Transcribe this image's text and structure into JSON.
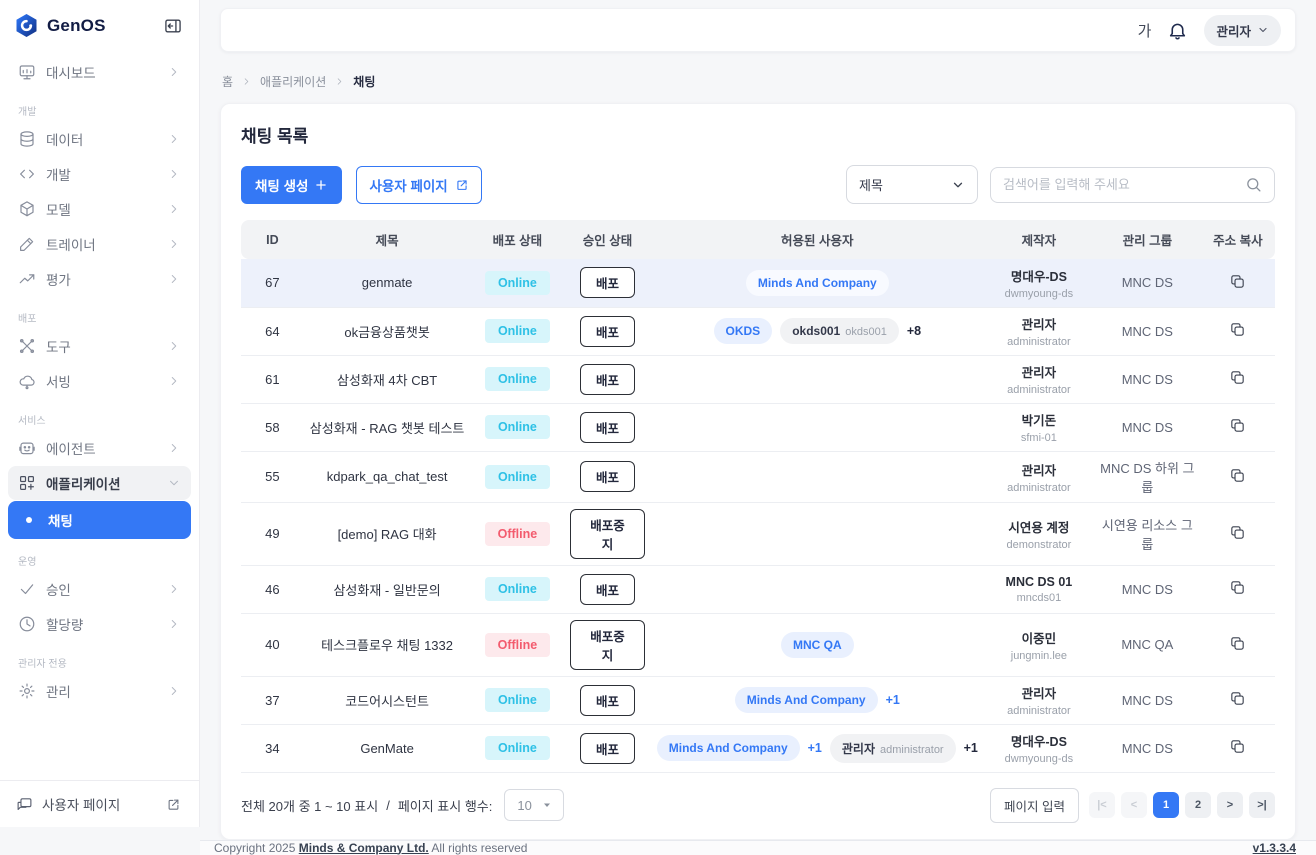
{
  "sidebar": {
    "logo_text": "GenOS",
    "sections": [
      {
        "label": null,
        "items": [
          {
            "icon": "dashboard-icon",
            "label": "대시보드",
            "state": "default"
          }
        ]
      },
      {
        "label": "개발",
        "items": [
          {
            "icon": "database-icon",
            "label": "데이터",
            "state": "default"
          },
          {
            "icon": "code-icon",
            "label": "개발",
            "state": "default"
          },
          {
            "icon": "model-icon",
            "label": "모델",
            "state": "default"
          },
          {
            "icon": "trainer-icon",
            "label": "트레이너",
            "state": "default"
          },
          {
            "icon": "evaluation-icon",
            "label": "평가",
            "state": "default"
          }
        ]
      },
      {
        "label": "배포",
        "items": [
          {
            "icon": "tools-icon",
            "label": "도구",
            "state": "default"
          },
          {
            "icon": "serving-icon",
            "label": "서빙",
            "state": "default"
          }
        ]
      },
      {
        "label": "서비스",
        "items": [
          {
            "icon": "agent-icon",
            "label": "에이전트",
            "state": "default"
          },
          {
            "icon": "application-icon",
            "label": "애플리케이션",
            "state": "expanded"
          },
          {
            "icon": null,
            "label": "채팅",
            "state": "selected"
          }
        ]
      },
      {
        "label": "운영",
        "items": [
          {
            "icon": "approval-icon",
            "label": "승인",
            "state": "default"
          },
          {
            "icon": "quota-icon",
            "label": "할당량",
            "state": "default"
          }
        ]
      },
      {
        "label": "관리자 전용",
        "items": [
          {
            "icon": "admin-icon",
            "label": "관리",
            "state": "default"
          }
        ]
      }
    ],
    "footer_label": "사용자 페이지"
  },
  "topbar": {
    "font_size_label": "가",
    "user_menu_label": "관리자"
  },
  "breadcrumb": [
    "홈",
    "애플리케이션",
    "채팅"
  ],
  "page": {
    "title": "채팅 목록"
  },
  "toolbar": {
    "create_button": "채팅 생성",
    "user_page_button": "사용자 페이지",
    "filter_selected": "제목",
    "search_placeholder": "검색어를 입력해 주세요"
  },
  "table": {
    "columns": [
      "ID",
      "제목",
      "배포 상태",
      "승인 상태",
      "허용된 사용자",
      "제작자",
      "관리 그룹",
      "주소 복사"
    ],
    "rows": [
      {
        "id": "67",
        "title": "genmate",
        "status": "Online",
        "approval": "배포",
        "allowed": [
          {
            "kind": "pill-blue",
            "text": "Minds And Company"
          }
        ],
        "creator_name": "명대우-DS",
        "creator_id": "dwmyoung-ds",
        "group": "MNC DS",
        "highlighted": true
      },
      {
        "id": "64",
        "title": "ok금융상품챗봇",
        "status": "Online",
        "approval": "배포",
        "allowed": [
          {
            "kind": "pill-blue",
            "text": "OKDS"
          },
          {
            "kind": "pill-gray",
            "name": "okds001",
            "sub": "okds001"
          },
          {
            "kind": "more",
            "color": "dark",
            "text": "+8"
          }
        ],
        "creator_name": "관리자",
        "creator_id": "administrator",
        "group": "MNC DS",
        "highlighted": false
      },
      {
        "id": "61",
        "title": "삼성화재 4차 CBT",
        "status": "Online",
        "approval": "배포",
        "allowed": [],
        "creator_name": "관리자",
        "creator_id": "administrator",
        "group": "MNC DS",
        "highlighted": false
      },
      {
        "id": "58",
        "title": "삼성화재 - RAG 챗봇 테스트",
        "status": "Online",
        "approval": "배포",
        "allowed": [],
        "creator_name": "박기돈",
        "creator_id": "sfmi-01",
        "group": "MNC DS",
        "highlighted": false
      },
      {
        "id": "55",
        "title": "kdpark_qa_chat_test",
        "status": "Online",
        "approval": "배포",
        "allowed": [],
        "creator_name": "관리자",
        "creator_id": "administrator",
        "group": "MNC DS 하위 그룹",
        "highlighted": false
      },
      {
        "id": "49",
        "title": "[demo] RAG 대화",
        "status": "Offline",
        "approval": "배포중지",
        "allowed": [],
        "creator_name": "시연용 계정",
        "creator_id": "demonstrator",
        "group": "시연용 리소스 그룹",
        "highlighted": false
      },
      {
        "id": "46",
        "title": "삼성화재 - 일반문의",
        "status": "Online",
        "approval": "배포",
        "allowed": [],
        "creator_name": "MNC DS 01",
        "creator_id": "mncds01",
        "group": "MNC DS",
        "highlighted": false
      },
      {
        "id": "40",
        "title": "테스크플로우 채팅 1332",
        "status": "Offline",
        "approval": "배포중지",
        "allowed": [
          {
            "kind": "pill-blue",
            "text": "MNC QA"
          }
        ],
        "creator_name": "이중민",
        "creator_id": "jungmin.lee",
        "group": "MNC QA",
        "highlighted": false
      },
      {
        "id": "37",
        "title": "코드어시스턴트",
        "status": "Online",
        "approval": "배포",
        "allowed": [
          {
            "kind": "pill-blue",
            "text": "Minds And Company"
          },
          {
            "kind": "more",
            "color": "blue",
            "text": "+1"
          }
        ],
        "creator_name": "관리자",
        "creator_id": "administrator",
        "group": "MNC DS",
        "highlighted": false
      },
      {
        "id": "34",
        "title": "GenMate",
        "status": "Online",
        "approval": "배포",
        "allowed": [
          {
            "kind": "pill-blue",
            "text": "Minds And Company"
          },
          {
            "kind": "more",
            "color": "blue",
            "text": "+1"
          },
          {
            "kind": "pill-gray",
            "name": "관리자",
            "sub": "administrator"
          },
          {
            "kind": "more",
            "color": "dark",
            "text": "+1"
          }
        ],
        "creator_name": "명대우-DS",
        "creator_id": "dwmyoung-ds",
        "group": "MNC DS",
        "highlighted": false
      }
    ]
  },
  "pagination": {
    "summary": "전체 20개 중 1 ~ 10 표시",
    "separator": "/",
    "per_page_label": "페이지 표시 행수:",
    "per_page_value": "10",
    "page_input_label": "페이지 입력",
    "nav": [
      {
        "id": "first-page",
        "label": "|<",
        "state": "disabled"
      },
      {
        "id": "prev-page",
        "label": "<",
        "state": "disabled"
      },
      {
        "id": "page-1",
        "label": "1",
        "state": "active"
      },
      {
        "id": "page-2",
        "label": "2",
        "state": "normal"
      },
      {
        "id": "next-page",
        "label": ">",
        "state": "normal"
      },
      {
        "id": "last-page",
        "label": ">|",
        "state": "normal"
      }
    ]
  },
  "footer": {
    "copyright_prefix": "Copyright 2025",
    "company": "Minds & Company Ltd.",
    "copyright_suffix": "All rights reserved",
    "version": "v1.3.3.4"
  },
  "colors": {
    "primary": "#3478f5",
    "online": "#2ec1e6",
    "offline": "#f35b6e",
    "selected_row": "#edf1fb"
  }
}
